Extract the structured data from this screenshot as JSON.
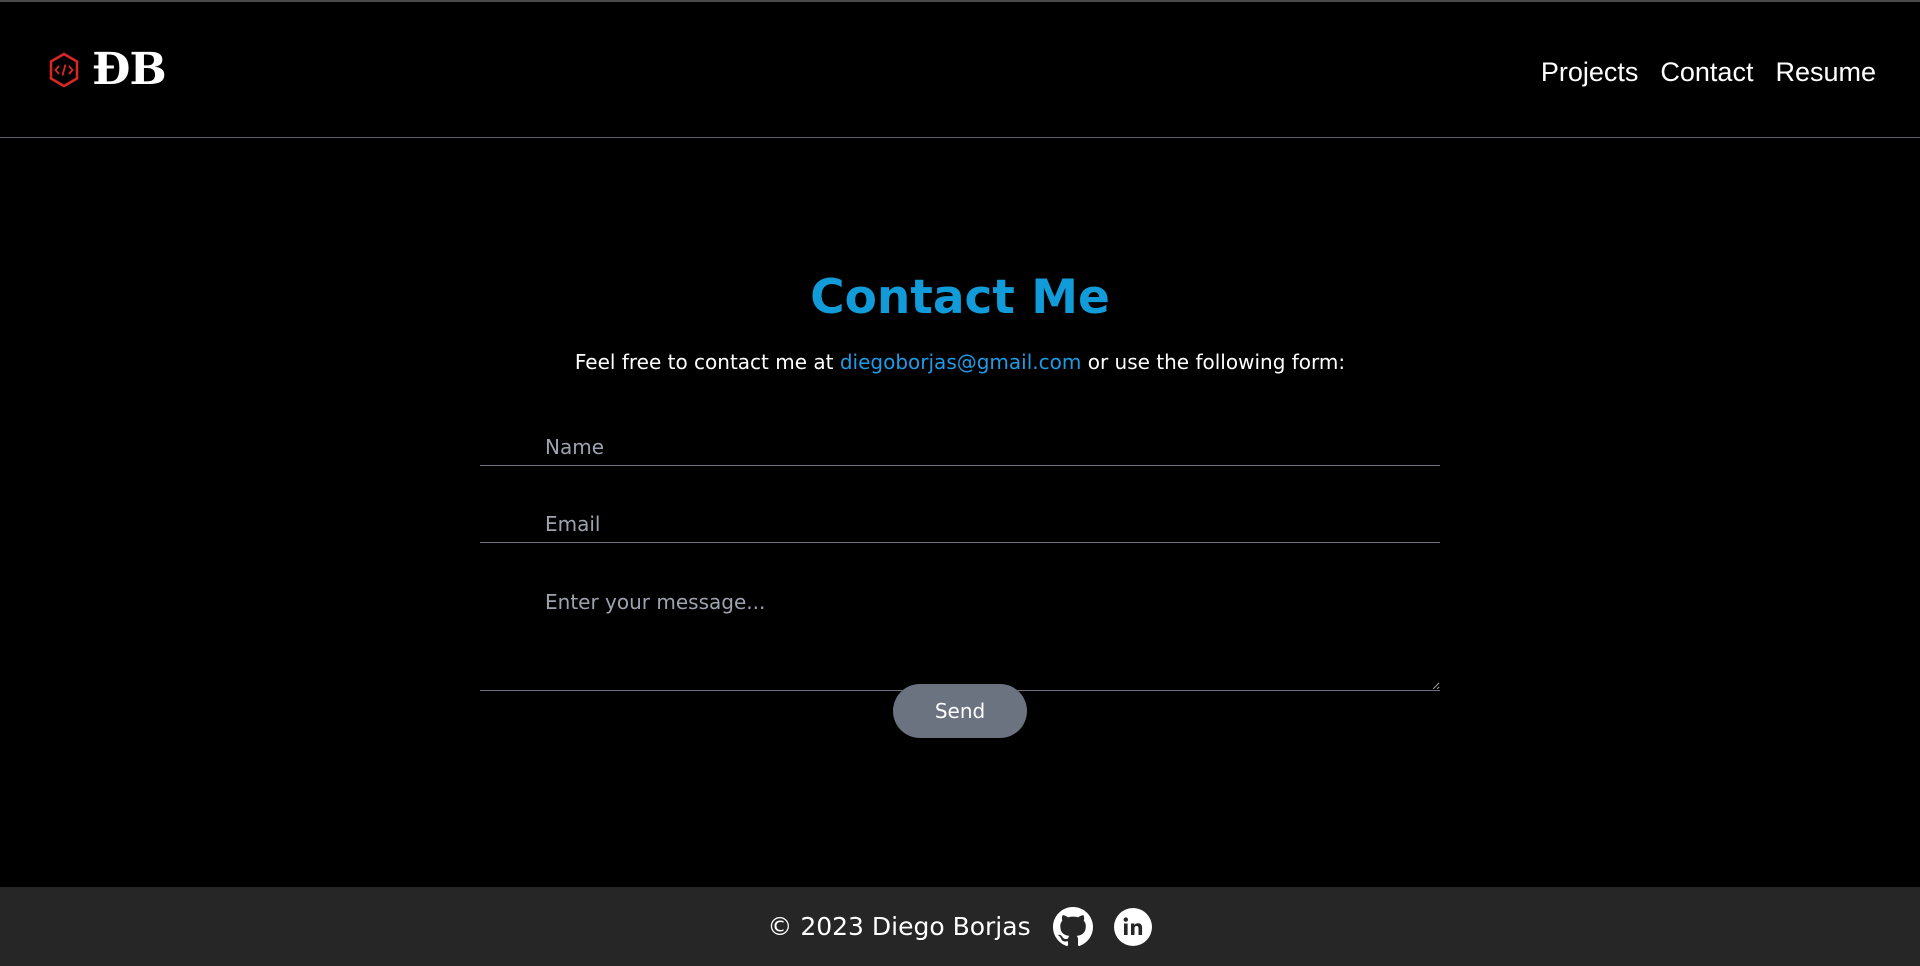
{
  "brand": {
    "logo_text": "ĐB",
    "logo_icon": "code-hexagon-icon",
    "accent_color": "#dc2626"
  },
  "nav": {
    "items": [
      {
        "label": "Projects"
      },
      {
        "label": "Contact"
      },
      {
        "label": "Resume"
      }
    ]
  },
  "main": {
    "title": "Contact Me",
    "subtitle_before": "Feel free to contact me at ",
    "email_link": "diegoborjas@gmail.com",
    "subtitle_after": " or use the following form:",
    "title_color": "#129bd9",
    "link_color": "#1d9be6"
  },
  "form": {
    "name_placeholder": "Name",
    "email_placeholder": "Email",
    "message_placeholder": "Enter your message...",
    "send_label": "Send",
    "button_color": "#6b7280"
  },
  "footer": {
    "copyright": "© 2023 Diego Borjas",
    "social": [
      {
        "icon": "github-icon"
      },
      {
        "icon": "linkedin-icon"
      }
    ],
    "background": "#262626"
  }
}
